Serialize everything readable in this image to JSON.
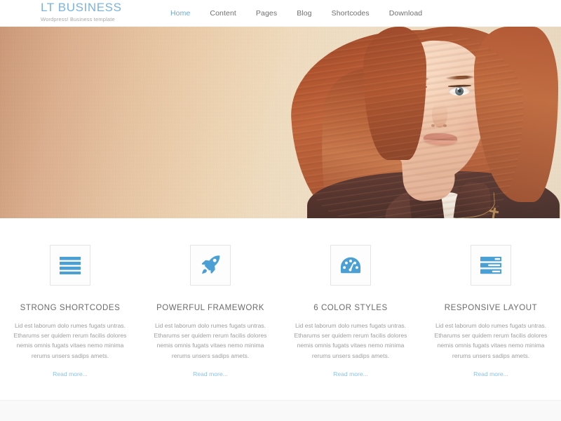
{
  "brand": {
    "title": "LT BUSINESS",
    "tagline": "Wordpress! Business template",
    "color": "#79b4e0"
  },
  "nav": {
    "items": [
      {
        "label": "Home",
        "active": true
      },
      {
        "label": "Content",
        "active": false
      },
      {
        "label": "Pages",
        "active": false
      },
      {
        "label": "Blog",
        "active": false
      },
      {
        "label": "Shortcodes",
        "active": false
      },
      {
        "label": "Download",
        "active": false
      }
    ],
    "active_color": "#6fa8d8",
    "item_color": "#6f6f6f"
  },
  "hero": {
    "alt": "Smiling young woman with long auburn hair in dark blazer against warm beige wall",
    "background_start": "#c99a7d",
    "background_end": "#e9d9c2"
  },
  "features": {
    "accent_color": "#4a9fd5",
    "link_color": "#8cc2e8",
    "items": [
      {
        "icon": "list-bars-icon",
        "title": "STRONG SHORTCODES",
        "text": "Lid est laborum dolo rumes fugats untras. Etharums ser quidem rerum facilis dolores nemis omnis fugats vitaes nemo minima rerums unsers sadips amets.",
        "link": "Read more..."
      },
      {
        "icon": "rocket-icon",
        "title": "POWERFUL FRAMEWORK",
        "text": "Lid est laborum dolo rumes fugats untras. Etharums ser quidem rerum facilis dolores nemis omnis fugats vitaes nemo minima rerums unsers sadips amets.",
        "link": "Read more..."
      },
      {
        "icon": "dashboard-gauge-icon",
        "title": "6 COLOR STYLES",
        "text": "Lid est laborum dolo rumes fugats untras. Etharums ser quidem rerum facilis dolores nemis omnis fugats vitaes nemo minima rerums unsers sadips amets.",
        "link": "Read more..."
      },
      {
        "icon": "server-rows-icon",
        "title": "RESPONSIVE LAYOUT",
        "text": "Lid est laborum dolo rumes fugats untras. Etharums ser quidem rerum facilis dolores nemis omnis fugats vitaes nemo minima rerums unsers sadips amets.",
        "link": "Read more..."
      }
    ]
  },
  "footer": {
    "background": "#f9f9f9"
  }
}
